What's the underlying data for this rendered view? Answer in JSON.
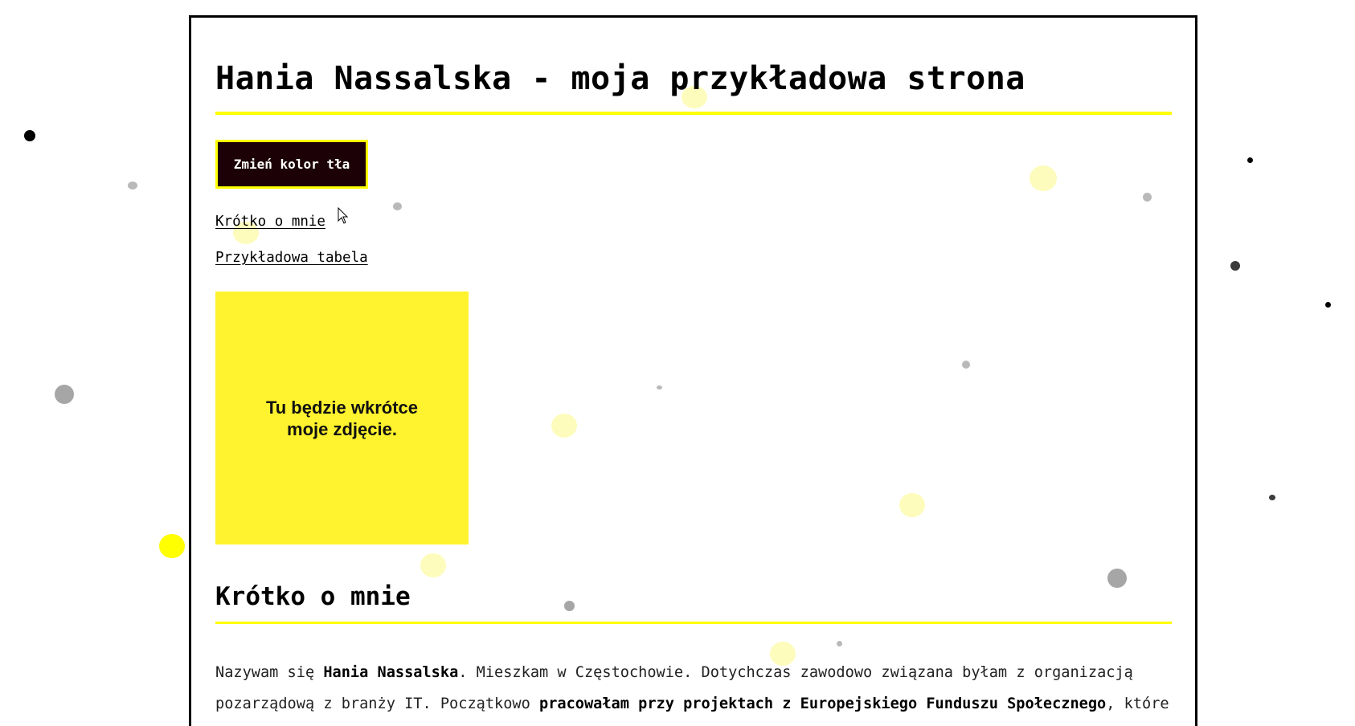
{
  "header": {
    "title": "Hania Nassalska - moja przykładowa strona"
  },
  "toolbar": {
    "change_bg_label": "Zmień kolor tła"
  },
  "nav": {
    "items": [
      {
        "label": "Krótko o mnie"
      },
      {
        "label": "Przykładowa tabela"
      }
    ]
  },
  "photo": {
    "placeholder_line1": "Tu będzie wkrótce",
    "placeholder_line2": "moje zdjęcie."
  },
  "about": {
    "heading": "Krótko o mnie",
    "p_part1": "Nazywam się ",
    "p_name": "Hania Nassalska",
    "p_part2": ". Mieszkam w Częstochowie. Dotychczas zawodowo związana byłam z organizacją pozarządową z branży IT. Początkowo ",
    "p_bold2": "pracowałam przy projektach z Europejskiego Funduszu Społecznego",
    "p_part3": ", które moja organizacja kierowała do osób z niepełnosprawnościami,"
  },
  "colors": {
    "accent": "#ffff00",
    "button_bg": "#1c0206",
    "photo_bg": "#fff22e",
    "text": "#000000"
  }
}
